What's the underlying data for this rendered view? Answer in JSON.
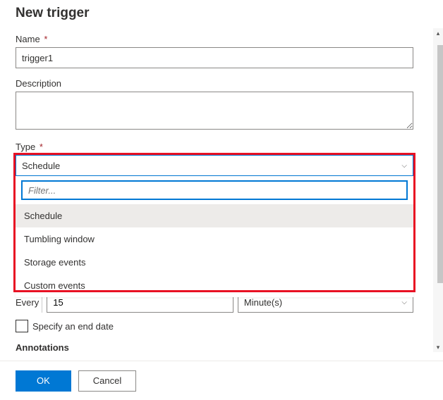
{
  "header": {
    "title": "New trigger"
  },
  "fields": {
    "name": {
      "label": "Name",
      "required": "*",
      "value": "trigger1"
    },
    "description": {
      "label": "Description",
      "value": ""
    },
    "type": {
      "label": "Type",
      "required": "*",
      "selected": "Schedule",
      "filter_placeholder": "Filter...",
      "options": [
        "Schedule",
        "Tumbling window",
        "Storage events",
        "Custom events"
      ]
    },
    "recurrence": {
      "every_label": "Every",
      "every_value": "15",
      "unit": "Minute(s)"
    },
    "end_date": {
      "label": "Specify an end date",
      "checked": false
    },
    "annotations": {
      "label": "Annotations"
    }
  },
  "footer": {
    "ok": "OK",
    "cancel": "Cancel"
  }
}
